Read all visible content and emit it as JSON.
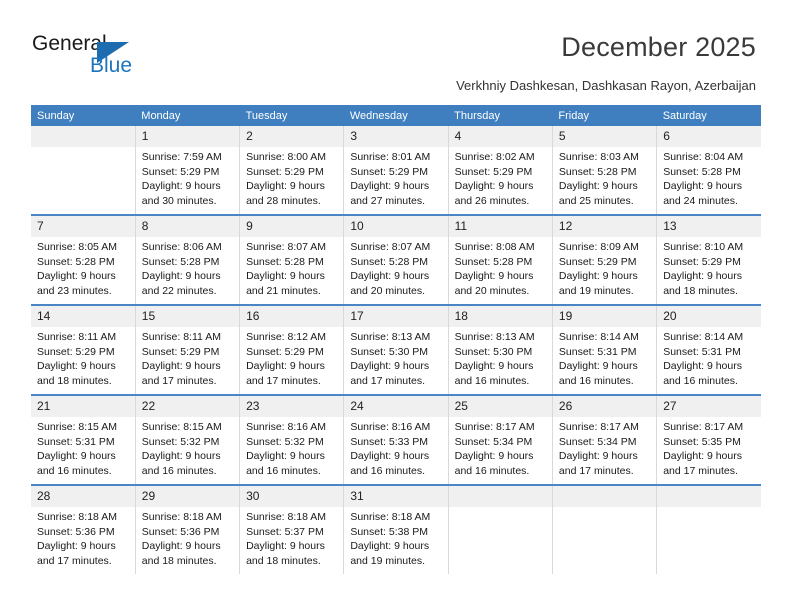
{
  "brand": {
    "name_part1": "General",
    "name_part2": "Blue",
    "logo_icon": "triangle-logo-icon",
    "accent_color": "#1d6cb0"
  },
  "header": {
    "title": "December 2025",
    "subtitle": "Verkhniy Dashkesan, Dashkasan Rayon, Azerbaijan"
  },
  "calendar": {
    "header_bg": "#3f7fbf",
    "weekdays": [
      "Sunday",
      "Monday",
      "Tuesday",
      "Wednesday",
      "Thursday",
      "Friday",
      "Saturday"
    ],
    "weeks": [
      [
        {
          "day": "",
          "sunrise": "",
          "sunset": "",
          "daylight_line1": "",
          "daylight_line2": "",
          "empty": true
        },
        {
          "day": "1",
          "sunrise": "Sunrise: 7:59 AM",
          "sunset": "Sunset: 5:29 PM",
          "daylight_line1": "Daylight: 9 hours",
          "daylight_line2": "and 30 minutes.",
          "empty": false
        },
        {
          "day": "2",
          "sunrise": "Sunrise: 8:00 AM",
          "sunset": "Sunset: 5:29 PM",
          "daylight_line1": "Daylight: 9 hours",
          "daylight_line2": "and 28 minutes.",
          "empty": false
        },
        {
          "day": "3",
          "sunrise": "Sunrise: 8:01 AM",
          "sunset": "Sunset: 5:29 PM",
          "daylight_line1": "Daylight: 9 hours",
          "daylight_line2": "and 27 minutes.",
          "empty": false
        },
        {
          "day": "4",
          "sunrise": "Sunrise: 8:02 AM",
          "sunset": "Sunset: 5:29 PM",
          "daylight_line1": "Daylight: 9 hours",
          "daylight_line2": "and 26 minutes.",
          "empty": false
        },
        {
          "day": "5",
          "sunrise": "Sunrise: 8:03 AM",
          "sunset": "Sunset: 5:28 PM",
          "daylight_line1": "Daylight: 9 hours",
          "daylight_line2": "and 25 minutes.",
          "empty": false
        },
        {
          "day": "6",
          "sunrise": "Sunrise: 8:04 AM",
          "sunset": "Sunset: 5:28 PM",
          "daylight_line1": "Daylight: 9 hours",
          "daylight_line2": "and 24 minutes.",
          "empty": false
        }
      ],
      [
        {
          "day": "7",
          "sunrise": "Sunrise: 8:05 AM",
          "sunset": "Sunset: 5:28 PM",
          "daylight_line1": "Daylight: 9 hours",
          "daylight_line2": "and 23 minutes.",
          "empty": false
        },
        {
          "day": "8",
          "sunrise": "Sunrise: 8:06 AM",
          "sunset": "Sunset: 5:28 PM",
          "daylight_line1": "Daylight: 9 hours",
          "daylight_line2": "and 22 minutes.",
          "empty": false
        },
        {
          "day": "9",
          "sunrise": "Sunrise: 8:07 AM",
          "sunset": "Sunset: 5:28 PM",
          "daylight_line1": "Daylight: 9 hours",
          "daylight_line2": "and 21 minutes.",
          "empty": false
        },
        {
          "day": "10",
          "sunrise": "Sunrise: 8:07 AM",
          "sunset": "Sunset: 5:28 PM",
          "daylight_line1": "Daylight: 9 hours",
          "daylight_line2": "and 20 minutes.",
          "empty": false
        },
        {
          "day": "11",
          "sunrise": "Sunrise: 8:08 AM",
          "sunset": "Sunset: 5:28 PM",
          "daylight_line1": "Daylight: 9 hours",
          "daylight_line2": "and 20 minutes.",
          "empty": false
        },
        {
          "day": "12",
          "sunrise": "Sunrise: 8:09 AM",
          "sunset": "Sunset: 5:29 PM",
          "daylight_line1": "Daylight: 9 hours",
          "daylight_line2": "and 19 minutes.",
          "empty": false
        },
        {
          "day": "13",
          "sunrise": "Sunrise: 8:10 AM",
          "sunset": "Sunset: 5:29 PM",
          "daylight_line1": "Daylight: 9 hours",
          "daylight_line2": "and 18 minutes.",
          "empty": false
        }
      ],
      [
        {
          "day": "14",
          "sunrise": "Sunrise: 8:11 AM",
          "sunset": "Sunset: 5:29 PM",
          "daylight_line1": "Daylight: 9 hours",
          "daylight_line2": "and 18 minutes.",
          "empty": false
        },
        {
          "day": "15",
          "sunrise": "Sunrise: 8:11 AM",
          "sunset": "Sunset: 5:29 PM",
          "daylight_line1": "Daylight: 9 hours",
          "daylight_line2": "and 17 minutes.",
          "empty": false
        },
        {
          "day": "16",
          "sunrise": "Sunrise: 8:12 AM",
          "sunset": "Sunset: 5:29 PM",
          "daylight_line1": "Daylight: 9 hours",
          "daylight_line2": "and 17 minutes.",
          "empty": false
        },
        {
          "day": "17",
          "sunrise": "Sunrise: 8:13 AM",
          "sunset": "Sunset: 5:30 PM",
          "daylight_line1": "Daylight: 9 hours",
          "daylight_line2": "and 17 minutes.",
          "empty": false
        },
        {
          "day": "18",
          "sunrise": "Sunrise: 8:13 AM",
          "sunset": "Sunset: 5:30 PM",
          "daylight_line1": "Daylight: 9 hours",
          "daylight_line2": "and 16 minutes.",
          "empty": false
        },
        {
          "day": "19",
          "sunrise": "Sunrise: 8:14 AM",
          "sunset": "Sunset: 5:31 PM",
          "daylight_line1": "Daylight: 9 hours",
          "daylight_line2": "and 16 minutes.",
          "empty": false
        },
        {
          "day": "20",
          "sunrise": "Sunrise: 8:14 AM",
          "sunset": "Sunset: 5:31 PM",
          "daylight_line1": "Daylight: 9 hours",
          "daylight_line2": "and 16 minutes.",
          "empty": false
        }
      ],
      [
        {
          "day": "21",
          "sunrise": "Sunrise: 8:15 AM",
          "sunset": "Sunset: 5:31 PM",
          "daylight_line1": "Daylight: 9 hours",
          "daylight_line2": "and 16 minutes.",
          "empty": false
        },
        {
          "day": "22",
          "sunrise": "Sunrise: 8:15 AM",
          "sunset": "Sunset: 5:32 PM",
          "daylight_line1": "Daylight: 9 hours",
          "daylight_line2": "and 16 minutes.",
          "empty": false
        },
        {
          "day": "23",
          "sunrise": "Sunrise: 8:16 AM",
          "sunset": "Sunset: 5:32 PM",
          "daylight_line1": "Daylight: 9 hours",
          "daylight_line2": "and 16 minutes.",
          "empty": false
        },
        {
          "day": "24",
          "sunrise": "Sunrise: 8:16 AM",
          "sunset": "Sunset: 5:33 PM",
          "daylight_line1": "Daylight: 9 hours",
          "daylight_line2": "and 16 minutes.",
          "empty": false
        },
        {
          "day": "25",
          "sunrise": "Sunrise: 8:17 AM",
          "sunset": "Sunset: 5:34 PM",
          "daylight_line1": "Daylight: 9 hours",
          "daylight_line2": "and 16 minutes.",
          "empty": false
        },
        {
          "day": "26",
          "sunrise": "Sunrise: 8:17 AM",
          "sunset": "Sunset: 5:34 PM",
          "daylight_line1": "Daylight: 9 hours",
          "daylight_line2": "and 17 minutes.",
          "empty": false
        },
        {
          "day": "27",
          "sunrise": "Sunrise: 8:17 AM",
          "sunset": "Sunset: 5:35 PM",
          "daylight_line1": "Daylight: 9 hours",
          "daylight_line2": "and 17 minutes.",
          "empty": false
        }
      ],
      [
        {
          "day": "28",
          "sunrise": "Sunrise: 8:18 AM",
          "sunset": "Sunset: 5:36 PM",
          "daylight_line1": "Daylight: 9 hours",
          "daylight_line2": "and 17 minutes.",
          "empty": false
        },
        {
          "day": "29",
          "sunrise": "Sunrise: 8:18 AM",
          "sunset": "Sunset: 5:36 PM",
          "daylight_line1": "Daylight: 9 hours",
          "daylight_line2": "and 18 minutes.",
          "empty": false
        },
        {
          "day": "30",
          "sunrise": "Sunrise: 8:18 AM",
          "sunset": "Sunset: 5:37 PM",
          "daylight_line1": "Daylight: 9 hours",
          "daylight_line2": "and 18 minutes.",
          "empty": false
        },
        {
          "day": "31",
          "sunrise": "Sunrise: 8:18 AM",
          "sunset": "Sunset: 5:38 PM",
          "daylight_line1": "Daylight: 9 hours",
          "daylight_line2": "and 19 minutes.",
          "empty": false
        },
        {
          "day": "",
          "sunrise": "",
          "sunset": "",
          "daylight_line1": "",
          "daylight_line2": "",
          "empty": true
        },
        {
          "day": "",
          "sunrise": "",
          "sunset": "",
          "daylight_line1": "",
          "daylight_line2": "",
          "empty": true
        },
        {
          "day": "",
          "sunrise": "",
          "sunset": "",
          "daylight_line1": "",
          "daylight_line2": "",
          "empty": true
        }
      ]
    ]
  }
}
